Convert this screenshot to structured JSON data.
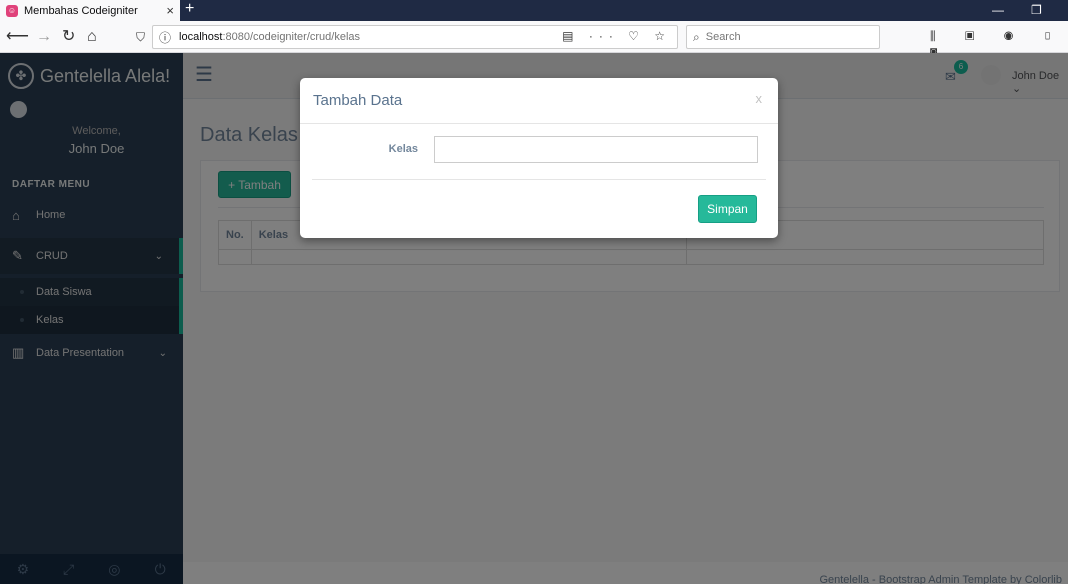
{
  "browser": {
    "tab_title": "Membahas Codeigniter",
    "tab_icon_glyph": "☺",
    "url_host": "localhost",
    "url_path": ":8080/codeigniter/crud/kelas",
    "search_placeholder": "Search",
    "new_tab_glyph": "+",
    "close_tab_glyph": "×"
  },
  "sidebar": {
    "brand": "Gentelella Alela!",
    "welcome": "Welcome,",
    "user": "John Doe",
    "menu_heading": "DAFTAR MENU",
    "items": [
      {
        "label": "Home",
        "icon": "home-icon"
      },
      {
        "label": "CRUD",
        "icon": "edit-icon"
      },
      {
        "label": "Data Presentation",
        "icon": "bar-chart-icon"
      }
    ],
    "sub_items": [
      {
        "label": "Data Siswa"
      },
      {
        "label": "Kelas"
      }
    ]
  },
  "topnav": {
    "mail_badge": "6",
    "user_name": "John Doe ⌄"
  },
  "page": {
    "title": "Data Kelas",
    "add_button": "+ Tambah",
    "table_headers": [
      "No.",
      "Kelas",
      ""
    ]
  },
  "footer": {
    "text": "Gentelella - Bootstrap Admin Template by Colorlib"
  },
  "modal": {
    "title": "Tambah Data",
    "close": "x",
    "field_label": "Kelas",
    "field_value": "",
    "save_button": "Simpan"
  },
  "colors": {
    "accent": "#1abb9c",
    "button": "#26b99a",
    "sidebar": "#2a3f54"
  }
}
